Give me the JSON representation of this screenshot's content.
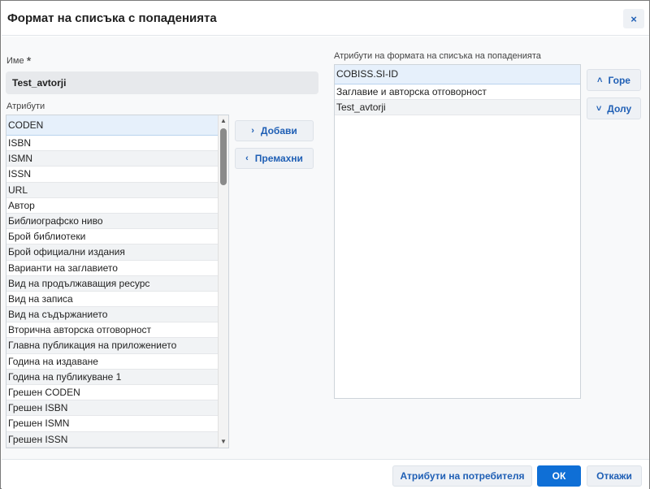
{
  "dialog": {
    "title": "Формат на списъка с попаденията",
    "close_icon": "×"
  },
  "name_section": {
    "label": "Име",
    "required_mark": "*",
    "value": "Test_avtorji"
  },
  "attributes": {
    "label": "Атрибути",
    "items": [
      "CODEN",
      "ISBN",
      "ISMN",
      "ISSN",
      "URL",
      "Автор",
      "Библиографско ниво",
      "Брой библиотеки",
      "Брой официални издания",
      "Варианти на заглавието",
      "Вид на продължаващия ресурс",
      "Вид на записа",
      "Вид на съдържанието",
      "Вторична авторска отговорност",
      "Главна публикация на приложението",
      "Година на издаване",
      "Година на публикуване 1",
      "Грешен CODEN",
      "Грешен ISBN",
      "Грешен ISMN",
      "Грешен ISSN"
    ]
  },
  "move_buttons": {
    "add_label": "Добави",
    "remove_label": "Премахни",
    "add_icon": "›",
    "remove_icon": "‹"
  },
  "format_attributes": {
    "label": "Атрибути на формата на списъка на попаденията",
    "items": [
      "COBISS.SI-ID",
      "Заглавие и авторска отговорност",
      "Test_avtorji"
    ]
  },
  "order_buttons": {
    "up_label": "Горе",
    "down_label": "Долу",
    "up_icon": "˄",
    "down_icon": "˅"
  },
  "footer": {
    "user_attributes_label": "Атрибути на потребителя",
    "ok_label": "ОК",
    "cancel_label": "Откажи"
  },
  "colors": {
    "accent": "#0f6fd6",
    "link": "#1f5fb5",
    "selected_row": "#e6f0fb"
  }
}
